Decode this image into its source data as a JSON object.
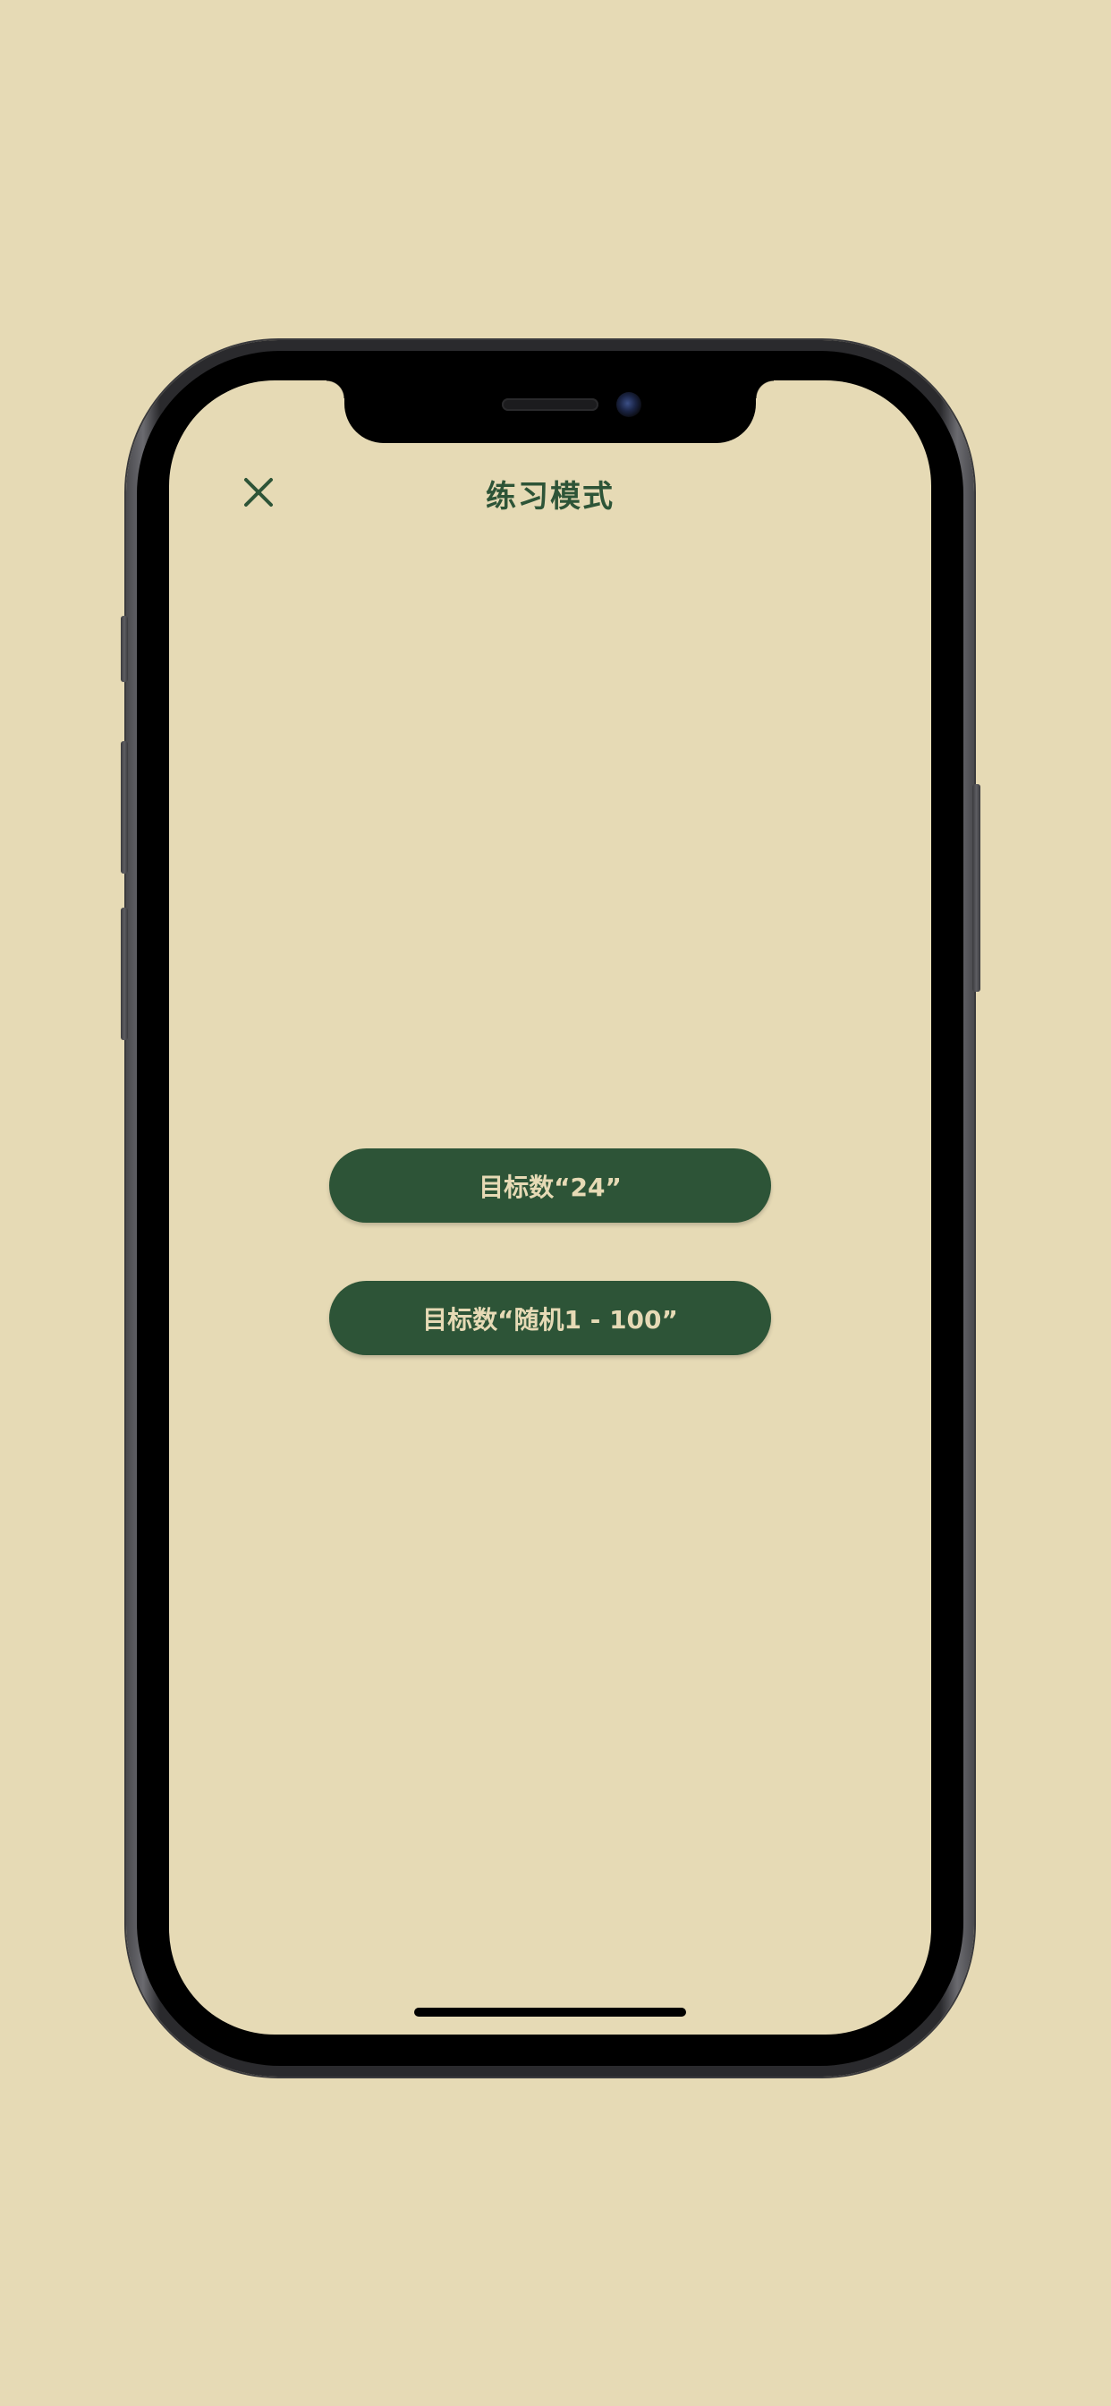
{
  "colors": {
    "background": "#e6dab5",
    "accent": "#2d5437",
    "button_text": "#e6dab5"
  },
  "header": {
    "close_icon": "close-icon",
    "title": "练习模式"
  },
  "main": {
    "buttons": [
      {
        "label": "目标数“24”"
      },
      {
        "label": "目标数“随机1 - 100”"
      }
    ]
  }
}
